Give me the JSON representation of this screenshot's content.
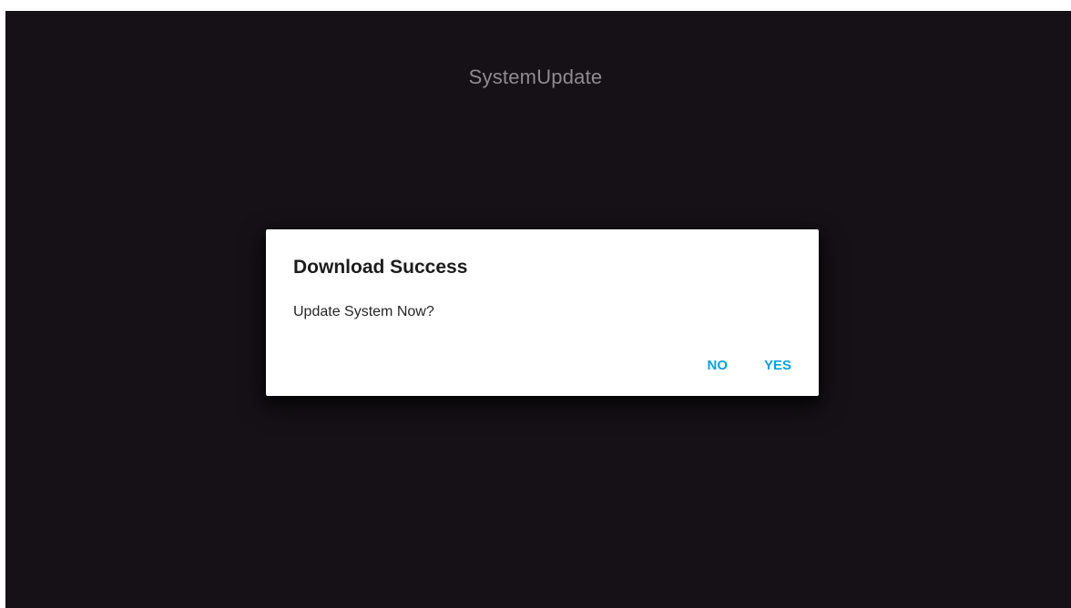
{
  "app": {
    "title": "SystemUpdate"
  },
  "dialog": {
    "title": "Download Success",
    "message": "Update System Now?",
    "buttons": {
      "no": "NO",
      "yes": "YES"
    }
  },
  "colors": {
    "background": "#151116",
    "dialog_background": "#ffffff",
    "accent": "#0aa2d8",
    "title_text": "#8e8c8f"
  }
}
